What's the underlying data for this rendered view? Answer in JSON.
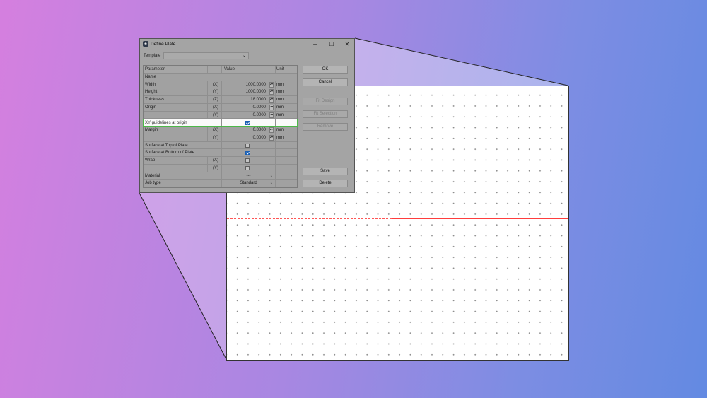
{
  "window": {
    "title": "Define Plate",
    "icon": "app-logo-icon",
    "controls": [
      "─",
      "☐",
      "✕"
    ]
  },
  "template": {
    "label": "Template",
    "value": "",
    "chevron": "⌄"
  },
  "grid": {
    "headers": {
      "parameter": "Parameter",
      "value": "Value",
      "unit": "Unit"
    },
    "rows": {
      "name": {
        "param": "Name"
      },
      "width": {
        "param": "Width",
        "axis": "(X)",
        "value": "1000.0000",
        "unit": "mm"
      },
      "height": {
        "param": "Height",
        "axis": "(Y)",
        "value": "1000.0000",
        "unit": "mm"
      },
      "thickness": {
        "param": "Thickness",
        "axis": "(Z)",
        "value": "18.0000",
        "unit": "mm"
      },
      "origin_x": {
        "param": "Origin",
        "axis": "(X)",
        "value": "0.0000",
        "unit": "mm"
      },
      "origin_y": {
        "param": "",
        "axis": "(Y)",
        "value": "0.0000",
        "unit": "mm"
      },
      "xy_guides": {
        "param": "XY guidelines at origin",
        "checked": true
      },
      "margin_x": {
        "param": "Margin",
        "axis": "(X)",
        "value": "0.0000",
        "unit": "mm"
      },
      "margin_y": {
        "param": "",
        "axis": "(Y)",
        "value": "0.0000",
        "unit": "mm"
      },
      "surface_top": {
        "param": "Surface at Top of Plate",
        "checked": false
      },
      "surface_bottom": {
        "param": "Surface at Bottom of Plate",
        "checked": true
      },
      "wrap_x": {
        "param": "Wrap",
        "axis": "(X)",
        "checked": false
      },
      "wrap_y": {
        "param": "",
        "axis": "(Y)",
        "checked": false
      },
      "material": {
        "param": "Material",
        "value": "---"
      },
      "job_type": {
        "param": "Job type",
        "value": "Standard"
      }
    }
  },
  "buttons": {
    "ok": "OK",
    "cancel": "Cancel",
    "fit_design": "Fit Design",
    "fit_selection": "Fit Selection",
    "remove": "Remove",
    "save": "Save",
    "delete": "Delete"
  },
  "colors": {
    "guide": "#ff3d3d",
    "highlight_border": "#4cb848",
    "checkbox": "#1a5fb4"
  }
}
